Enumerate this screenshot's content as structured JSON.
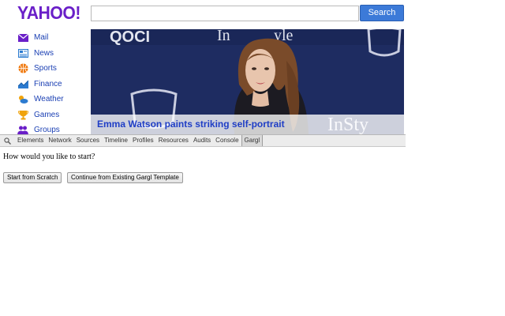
{
  "header": {
    "logo_text": "YAHOO!",
    "search_placeholder": "",
    "search_button": "Search"
  },
  "sidebar": {
    "items": [
      {
        "label": "Mail",
        "icon": "mail-icon",
        "color": "#6a1fc8"
      },
      {
        "label": "News",
        "icon": "news-icon",
        "color": "#2c7bd0"
      },
      {
        "label": "Sports",
        "icon": "sports-icon",
        "color": "#f07b12"
      },
      {
        "label": "Finance",
        "icon": "finance-icon",
        "color": "#2c7bd0"
      },
      {
        "label": "Weather",
        "icon": "weather-icon",
        "color": "#2c7bd0"
      },
      {
        "label": "Games",
        "icon": "games-icon",
        "color": "#f0a30b"
      },
      {
        "label": "Groups",
        "icon": "groups-icon",
        "color": "#6a1fc8"
      }
    ]
  },
  "hero": {
    "headline": "Emma Watson paints striking self-portrait",
    "background_color": "#1e2c61"
  },
  "devtools": {
    "tabs": [
      "Elements",
      "Network",
      "Sources",
      "Timeline",
      "Profiles",
      "Resources",
      "Audits",
      "Console",
      "Gargl"
    ],
    "active_tab": "Gargl"
  },
  "panel": {
    "question": "How would you like to start?",
    "start_scratch": "Start from Scratch",
    "continue_template": "Continue from Existing Gargl Template"
  }
}
